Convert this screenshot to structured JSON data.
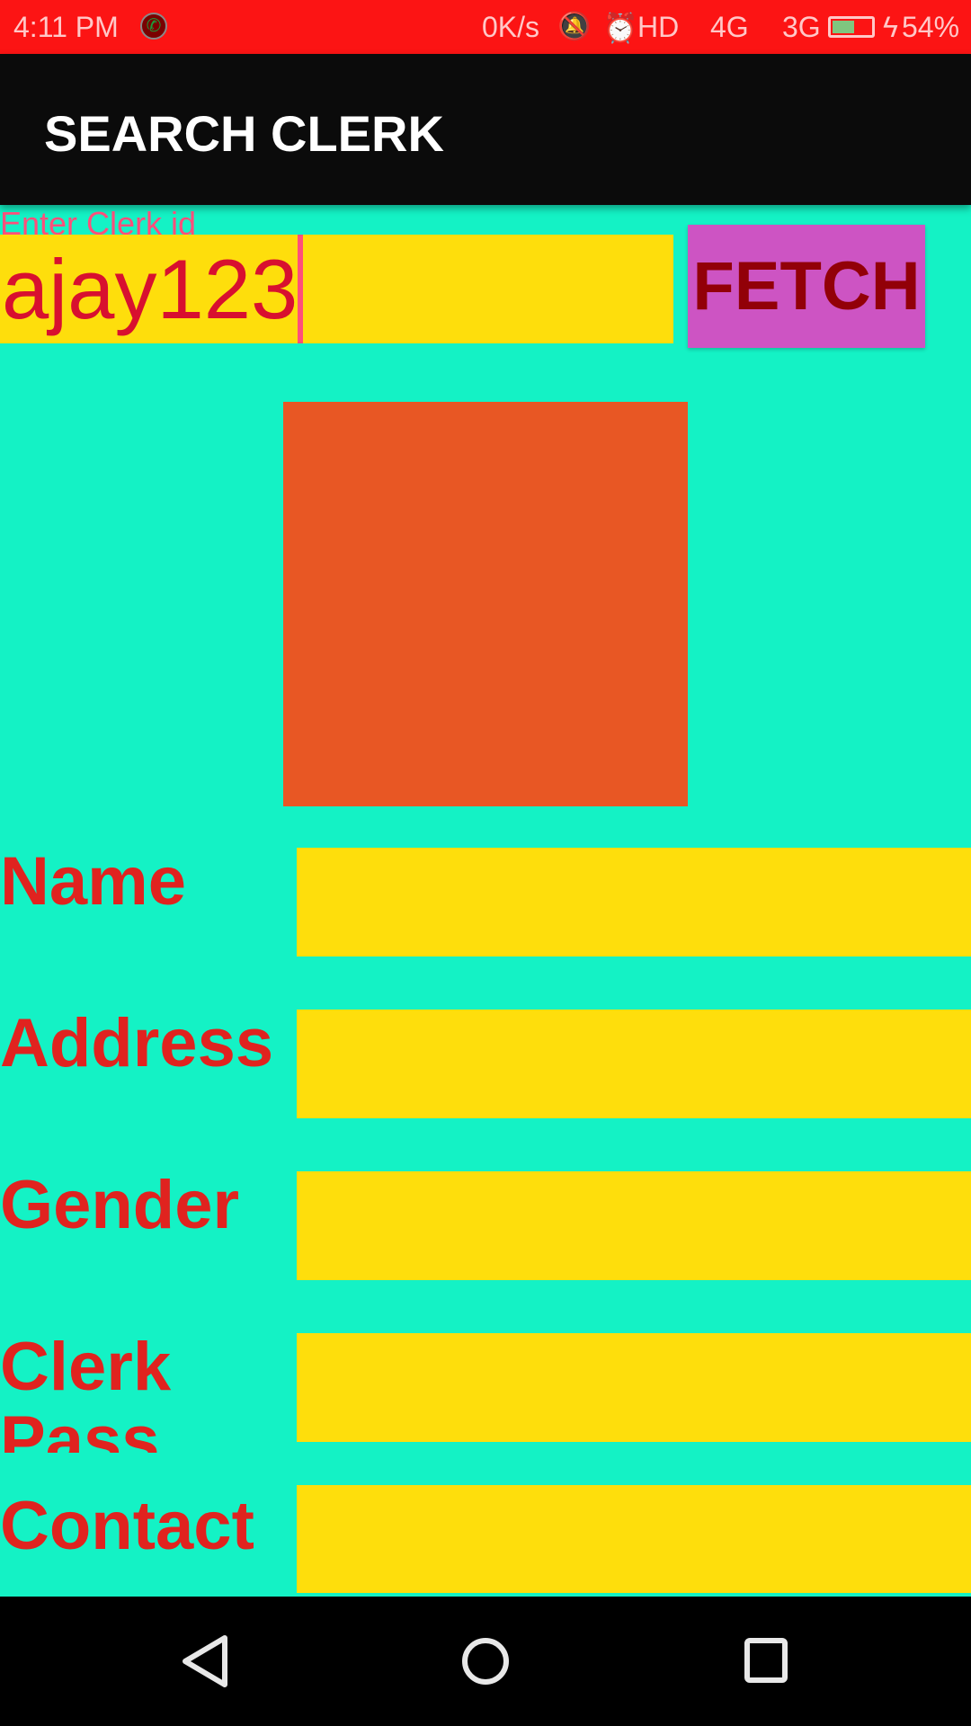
{
  "status_bar": {
    "time": "4:11 PM",
    "net_speed": "0K/s",
    "signal1": "HD",
    "signal2": "4G",
    "signal3": "3G",
    "battery": "54%",
    "battery_level": 54,
    "icons": [
      "call-recorder-icon",
      "bell-off-icon",
      "alarm-icon",
      "signal-icon",
      "battery-charging-icon"
    ]
  },
  "toolbar": {
    "title": "SEARCH CLERK"
  },
  "search": {
    "hint": "Enter Clerk id",
    "value": "ajay123",
    "fetch_label": "FETCH"
  },
  "colors": {
    "background": "#14F2C5",
    "field": "#FEDE0C",
    "label": "#E0231F",
    "button": "#CD54C3",
    "photo": "#E85724",
    "status_bar": "#FC1414"
  },
  "fields": [
    {
      "label": "Name",
      "value": ""
    },
    {
      "label": "Address",
      "value": ""
    },
    {
      "label": "Gender",
      "value": ""
    },
    {
      "label": "Clerk Pass",
      "value": ""
    },
    {
      "label": "Contact",
      "value": ""
    }
  ]
}
